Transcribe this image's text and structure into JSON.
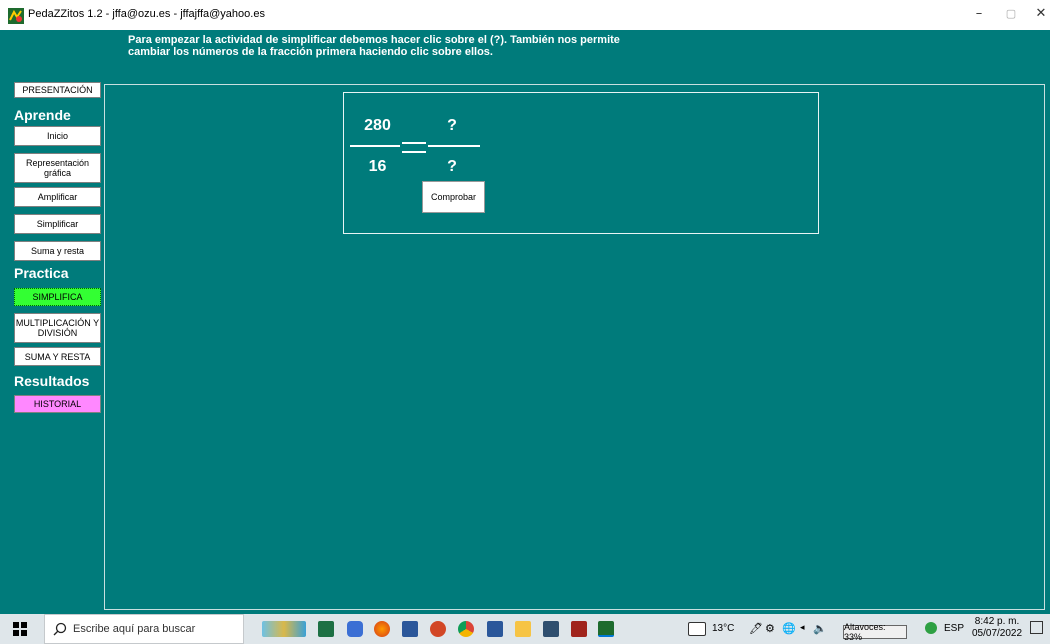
{
  "window": {
    "title": "PedaZZitos 1.2 - jffa@ozu.es - jffajffa@yahoo.es",
    "minimize": "–",
    "maximize": "▢",
    "close": "✕"
  },
  "instruction": {
    "line1": "Para empezar la actividad de simplificar debemos hacer clic sobre el (?). También nos permite",
    "line2": "cambiar los números de la fracción primera haciendo clic sobre ellos."
  },
  "menu": {
    "presentacion": "PRESENTACIÓN",
    "aprende_heading": "Aprende",
    "inicio": "Inicio",
    "representacion_1": "Representación",
    "representacion_2": "gráfica",
    "amplificar": "Amplificar",
    "simplificar": "Simplificar",
    "suma_resta": "Suma y resta",
    "practica_heading": "Practica",
    "simplifica": "SIMPLIFICA",
    "mult_div_1": "MULTIPLICACIÓN Y",
    "mult_div_2": "DIVISIÓN",
    "suma_y_resta": "SUMA Y RESTA",
    "resultados_heading": "Resultados",
    "historial": "HISTORIAL"
  },
  "fraction": {
    "numerator": "280",
    "denominator": "16",
    "equals": "=",
    "unknown_numerator": "?",
    "unknown_denominator": "?",
    "check_button": "Comprobar"
  },
  "taskbar": {
    "search_placeholder": "Escribe aquí para buscar",
    "weather": "13°C",
    "language": "ESP",
    "time": "8:42 p. m.",
    "date": "05/07/2022",
    "tooltip": "Altavoces: 33%"
  },
  "colors": {
    "background": "#007b7b",
    "simplifica_button": "#33ff33",
    "historial_button": "#ff88ff"
  }
}
